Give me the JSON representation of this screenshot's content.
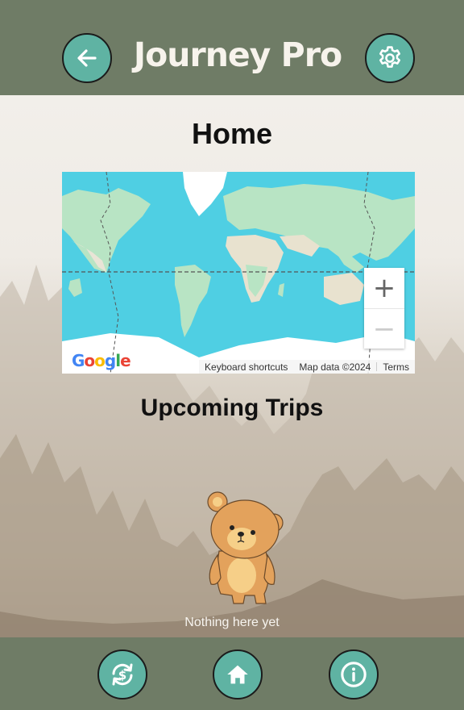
{
  "header": {
    "title": "Journey Pro",
    "back_icon": "arrow-left-icon",
    "settings_icon": "gear-icon"
  },
  "page": {
    "title": "Home"
  },
  "map": {
    "zoom_in_label": "+",
    "zoom_out_label": "−",
    "google_logo": "Google",
    "keyboard_shortcuts": "Keyboard shortcuts",
    "map_data": "Map data ©2024",
    "terms": "Terms"
  },
  "trips": {
    "title": "Upcoming Trips",
    "empty_text": "Nothing here yet"
  },
  "footer": {
    "buttons": [
      {
        "icon": "currency-exchange-icon"
      },
      {
        "icon": "home-icon"
      },
      {
        "icon": "info-icon"
      }
    ]
  },
  "colors": {
    "bar": "#6f7c66",
    "accent": "#5fb3a3",
    "ocean": "#4fcfe3",
    "land": "#b8e4c4"
  }
}
